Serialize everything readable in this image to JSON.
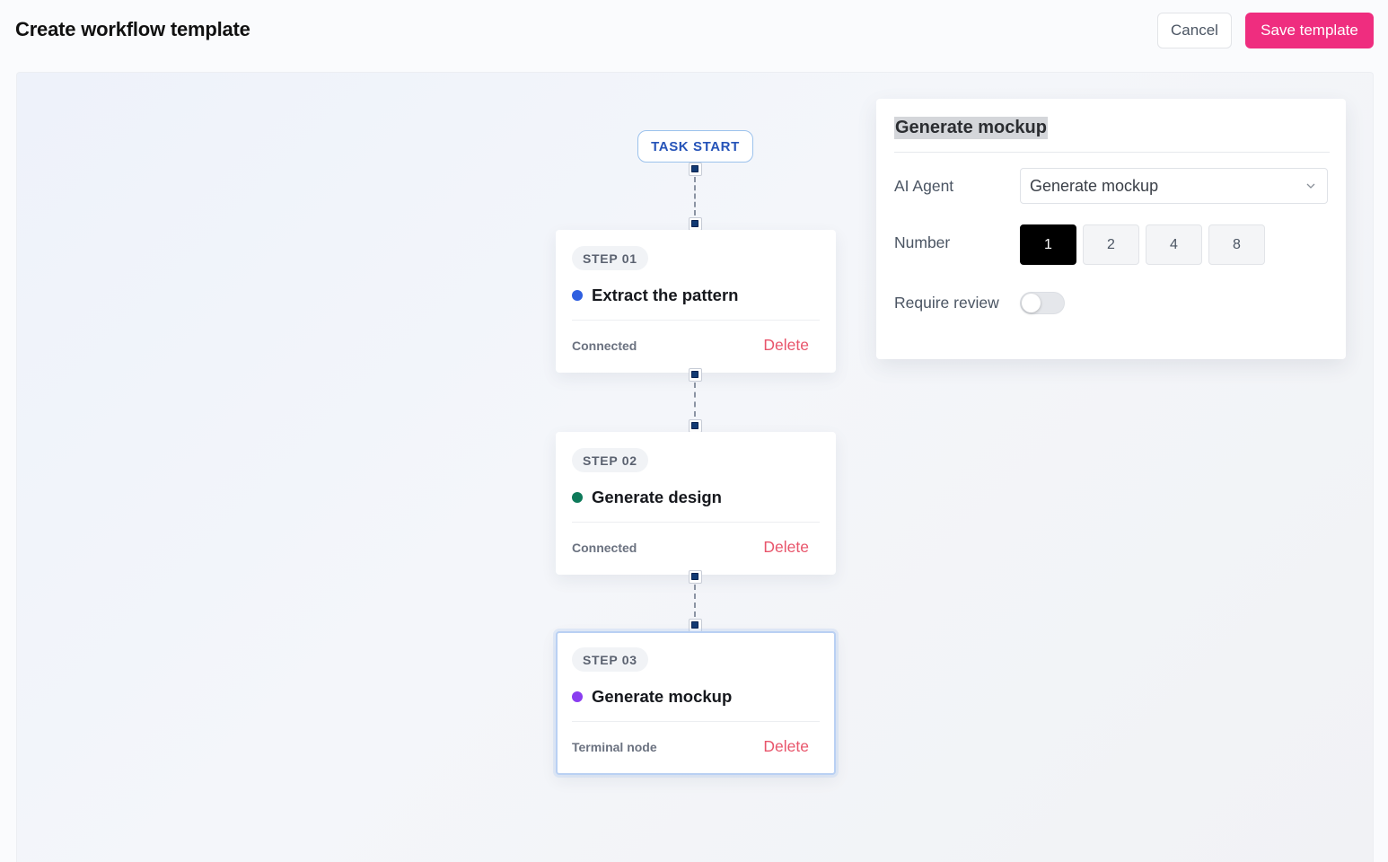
{
  "header": {
    "title": "Create workflow template",
    "cancel_label": "Cancel",
    "save_label": "Save template"
  },
  "workflow": {
    "start_label": "TASK START",
    "nodes": [
      {
        "step": "STEP 01",
        "title": "Extract the pattern",
        "status": "Connected",
        "delete_label": "Delete",
        "dot_color": "#2f5fe0",
        "selected": false
      },
      {
        "step": "STEP 02",
        "title": "Generate design",
        "status": "Connected",
        "delete_label": "Delete",
        "dot_color": "#0e7a5a",
        "selected": false
      },
      {
        "step": "STEP 03",
        "title": "Generate mockup",
        "status": "Terminal node",
        "delete_label": "Delete",
        "dot_color": "#8a3df0",
        "selected": true
      }
    ]
  },
  "panel": {
    "title": "Generate mockup",
    "agent_label": "AI Agent",
    "agent_value": "Generate mockup",
    "number_label": "Number",
    "number_options": [
      "1",
      "2",
      "4",
      "8"
    ],
    "number_selected": "1",
    "review_label": "Require review",
    "review_enabled": false
  },
  "colors": {
    "accent": "#ef2d7f",
    "delete": "#e8556b",
    "start_text": "#2553b8"
  }
}
